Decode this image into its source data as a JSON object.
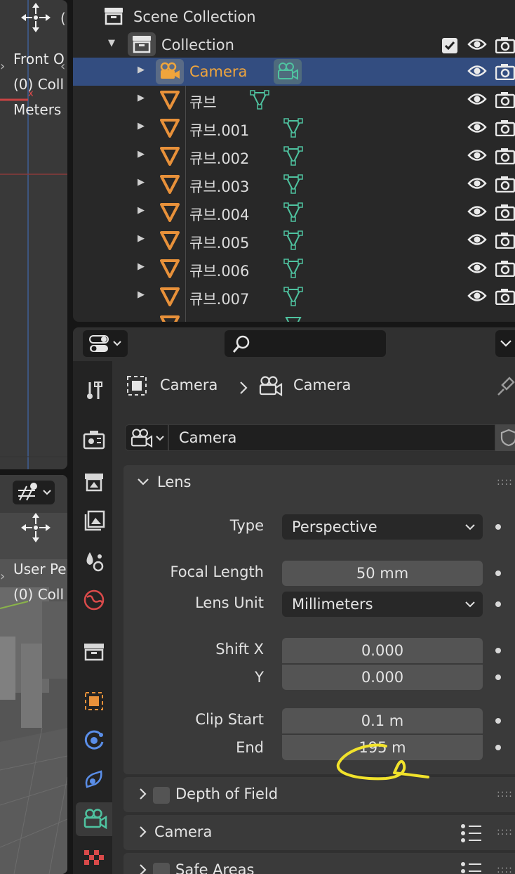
{
  "viewport_top": {
    "line1": "Front O",
    "line2": "(0) Coll",
    "line3": "Meters"
  },
  "viewport_bottom": {
    "line1": "User Pe",
    "line2": "(0) Coll"
  },
  "outliner": {
    "scene_collection": "Scene Collection",
    "collection": "Collection",
    "objects": [
      {
        "name": "Camera",
        "selected": true
      },
      {
        "name": "큐브"
      },
      {
        "name": "큐브.001"
      },
      {
        "name": "큐브.002"
      },
      {
        "name": "큐브.003"
      },
      {
        "name": "큐브.004"
      },
      {
        "name": "큐브.005"
      },
      {
        "name": "큐브.006"
      },
      {
        "name": "큐브.007"
      }
    ],
    "colors": {
      "camera_text": "#f0a53c",
      "mesh_icon": "#e8913a",
      "data_icon": "#4fc3a0",
      "selected_bg": "#334d80"
    }
  },
  "properties": {
    "breadcrumb": {
      "object": "Camera",
      "data": "Camera"
    },
    "datablock_name": "Camera",
    "lens_panel": {
      "title": "Lens",
      "type_label": "Type",
      "type_value": "Perspective",
      "focal_length_label": "Focal Length",
      "focal_length_value": "50 mm",
      "lens_unit_label": "Lens Unit",
      "lens_unit_value": "Millimeters",
      "shift_x_label": "Shift X",
      "shift_x_value": "0.000",
      "shift_y_label": "Y",
      "shift_y_value": "0.000",
      "clip_start_label": "Clip Start",
      "clip_start_value": "0.1 m",
      "clip_end_label": "End",
      "clip_end_value": "195 m"
    },
    "depth_of_field_title": "Depth of Field",
    "camera_panel_title": "Camera",
    "safe_areas_title": "Safe Areas"
  }
}
